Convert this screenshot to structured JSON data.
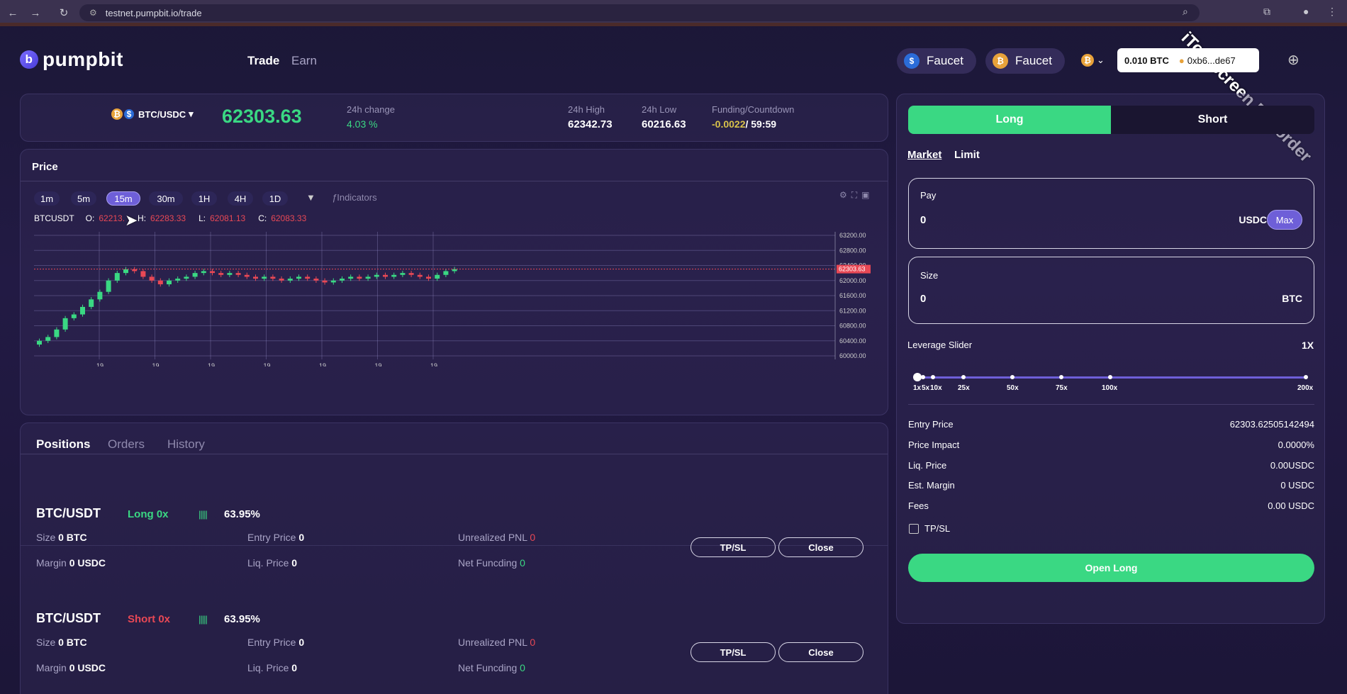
{
  "browser": {
    "url": "testnet.pumpbit.io/trade",
    "watermark": "iTop Screen Recorder"
  },
  "header": {
    "logo": "pumpbit",
    "nav": [
      "Trade",
      "Earn"
    ],
    "faucet1": "Faucet",
    "faucet2": "Faucet",
    "wallet_balance": "0.010 BTC",
    "wallet_address": "0xb6...de67"
  },
  "ticker": {
    "pair": "BTC/USDC",
    "price": "62303.63",
    "change_label": "24h change",
    "change": "4.03 %",
    "high_label": "24h High",
    "high": "62342.73",
    "low_label": "24h Low",
    "low": "60216.63",
    "funding_label": "Funding/Countdown",
    "funding": "-0.0022",
    "countdown": "/ 59:59"
  },
  "chart": {
    "title": "Price",
    "timeframes": [
      "1m",
      "5m",
      "15m",
      "30m",
      "1H",
      "4H",
      "1D"
    ],
    "active_tf": "15m",
    "indicators": "Indicators",
    "symbol": "BTCUSDT",
    "o_label": "O:",
    "o": "62213.",
    "h_label": "H:",
    "h": "62283.33",
    "l_label": "L:",
    "l": "62081.13",
    "c_label": "C:",
    "c": "62083.33",
    "current_price_tag": "62303.63"
  },
  "chart_data": {
    "type": "candlestick",
    "y_ticks": [
      "63200.00",
      "62800.00",
      "62400.00",
      "62000.00",
      "61600.00",
      "61200.00",
      "60800.00",
      "60400.00",
      "60000.00"
    ],
    "x_ticks": [
      "19",
      "19",
      "19",
      "19",
      "19",
      "19",
      "19"
    ],
    "ylim": [
      60000,
      63200
    ]
  },
  "positions": {
    "tabs": [
      "Positions",
      "Orders",
      "History"
    ],
    "rows": [
      {
        "pair": "BTC/USDT",
        "side": "Long 0x",
        "pct": "63.95%",
        "size_label": "Size",
        "size": "0 BTC",
        "entry_label": "Entry Price",
        "entry": "0",
        "upnl_label": "Unrealized PNL",
        "upnl": "0",
        "margin_label": "Margin",
        "margin": "0 USDC",
        "liq_label": "Liq. Price",
        "liq": "0",
        "nf_label": "Net Funcding",
        "nf": "0",
        "tpsl": "TP/SL",
        "close": "Close"
      },
      {
        "pair": "BTC/USDT",
        "side": "Short 0x",
        "pct": "63.95%",
        "size_label": "Size",
        "size": "0 BTC",
        "entry_label": "Entry Price",
        "entry": "0",
        "upnl_label": "Unrealized PNL",
        "upnl": "0",
        "margin_label": "Margin",
        "margin": "0 USDC",
        "liq_label": "Liq. Price",
        "liq": "0",
        "nf_label": "Net Funcding",
        "nf": "0",
        "tpsl": "TP/SL",
        "close": "Close"
      }
    ]
  },
  "order": {
    "long": "Long",
    "short": "Short",
    "market": "Market",
    "limit": "Limit",
    "pay_label": "Pay",
    "pay_value": "0",
    "pay_unit": "USDC",
    "max": "Max",
    "size_label": "Size",
    "size_value": "0",
    "size_unit": "BTC",
    "leverage_label": "Leverage Slider",
    "leverage": "1X",
    "lev_marks": [
      "1x",
      "5x",
      "10x",
      "25x",
      "50x",
      "75x",
      "100x",
      "200x"
    ],
    "entry_label": "Entry Price",
    "entry": "62303.62505142494",
    "impact_label": "Price Impact",
    "impact": "0.0000%",
    "liq_label": "Liq. Price",
    "liq": "0.00USDC",
    "margin_label": "Est. Margin",
    "margin": "0 USDC",
    "fees_label": "Fees",
    "fees": "0.00 USDC",
    "tpsl": "TP/SL",
    "submit": "Open Long"
  }
}
